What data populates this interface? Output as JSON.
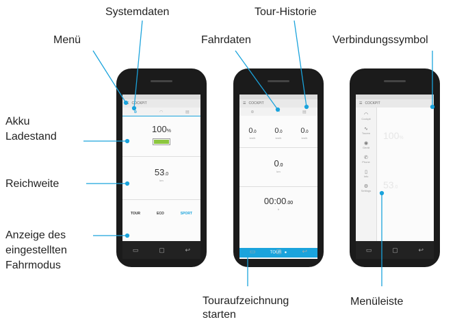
{
  "labels": {
    "systemdaten": "Systemdaten",
    "tour_historie": "Tour-Historie",
    "menu": "Menü",
    "fahrdaten": "Fahrdaten",
    "verbindungssymbol": "Verbindungssymbol",
    "akku_line1": "Akku",
    "akku_line2": "Ladestand",
    "reichweite": "Reichweite",
    "fahrmodus_line1": "Anzeige des",
    "fahrmodus_line2": "eingestellten",
    "fahrmodus_line3": "Fahrmodus",
    "touraufzeichnung_line1": "Touraufzeichnung",
    "touraufzeichnung_line2": "starten",
    "menueleiste": "Menüleiste"
  },
  "phone1": {
    "title": "COCKPIT",
    "battery": "100",
    "battery_unit": "%",
    "range": "53",
    "range_dec": ".0",
    "range_unit": "km",
    "modes": [
      "TOUR",
      "ECO",
      "SPORT"
    ],
    "battery_level": 1.0
  },
  "phone2": {
    "title": "COCKPIT",
    "speeds": [
      "0",
      "0",
      "0"
    ],
    "speed_dec": ".0",
    "speed_unit": "km/h",
    "distance": "0",
    "distance_dec": ".0",
    "distance_unit": "km",
    "time": "00:00",
    "time_dec": ".00",
    "time_unit": "h",
    "tour_button": "TOUR"
  },
  "phone3": {
    "title": "COCKPIT",
    "menu_items": [
      "Cockpit",
      "Touren",
      "Gerät",
      "Phone",
      "Info",
      "Settings"
    ],
    "bg_battery": "100",
    "bg_battery_unit": "%",
    "bg_range": "53",
    "bg_range_unit": ".0"
  },
  "colors": {
    "accent": "#1aa3dc",
    "battery_green": "#8cc63f",
    "phone_body": "#1b1b1b"
  }
}
